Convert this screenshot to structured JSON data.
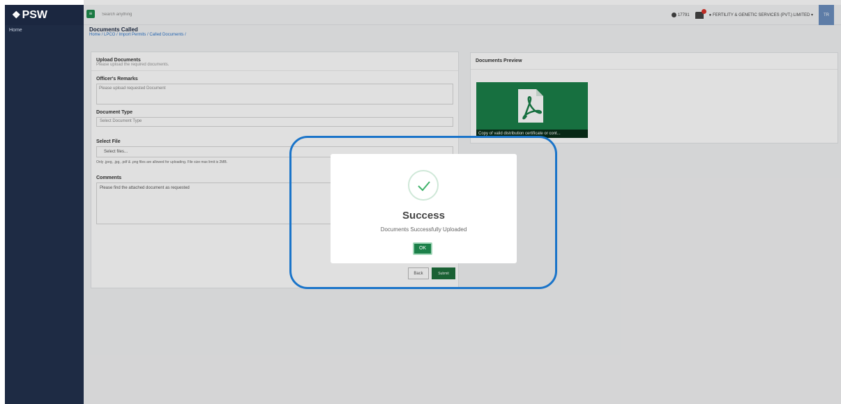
{
  "brand": {
    "logo_mark": "❖",
    "logo_text": "PSW"
  },
  "sidebar": {
    "items": [
      {
        "label": "Home"
      }
    ]
  },
  "topbar": {
    "search_placeholder": "Search anything",
    "counter": "17791",
    "user_name": "FERTILITY & GENETIC SERVICES (PVT.) LIMITED ▾",
    "avatar_initials": "TR"
  },
  "page": {
    "title": "Documents Called",
    "breadcrumb": "Home / LPCO / Import Permits / Called Documents /"
  },
  "upload": {
    "title": "Upload Documents",
    "subtitle": "Please upload the required documents.",
    "remarks_label": "Officer's Remarks",
    "remarks_value": "Please upload requested Document",
    "doc_type_label": "Document Type",
    "doc_type_placeholder": "Select Document Type",
    "file_label": "Select File",
    "file_button": "Select files...",
    "file_note": "Only .jpeg, .jpg, .pdf & .png files are allowed for uploading. File size max limit is 2MB.",
    "comments_label": "Comments",
    "comments_value": "Please find the attached document as requested",
    "back_label": "Back",
    "submit_label": "Submit"
  },
  "preview": {
    "title": "Documents Preview",
    "doc_caption": "Copy of valid distribution certificate or cont..."
  },
  "modal": {
    "title": "Success",
    "message": "Documents Successfully Uploaded",
    "ok_label": "OK"
  }
}
